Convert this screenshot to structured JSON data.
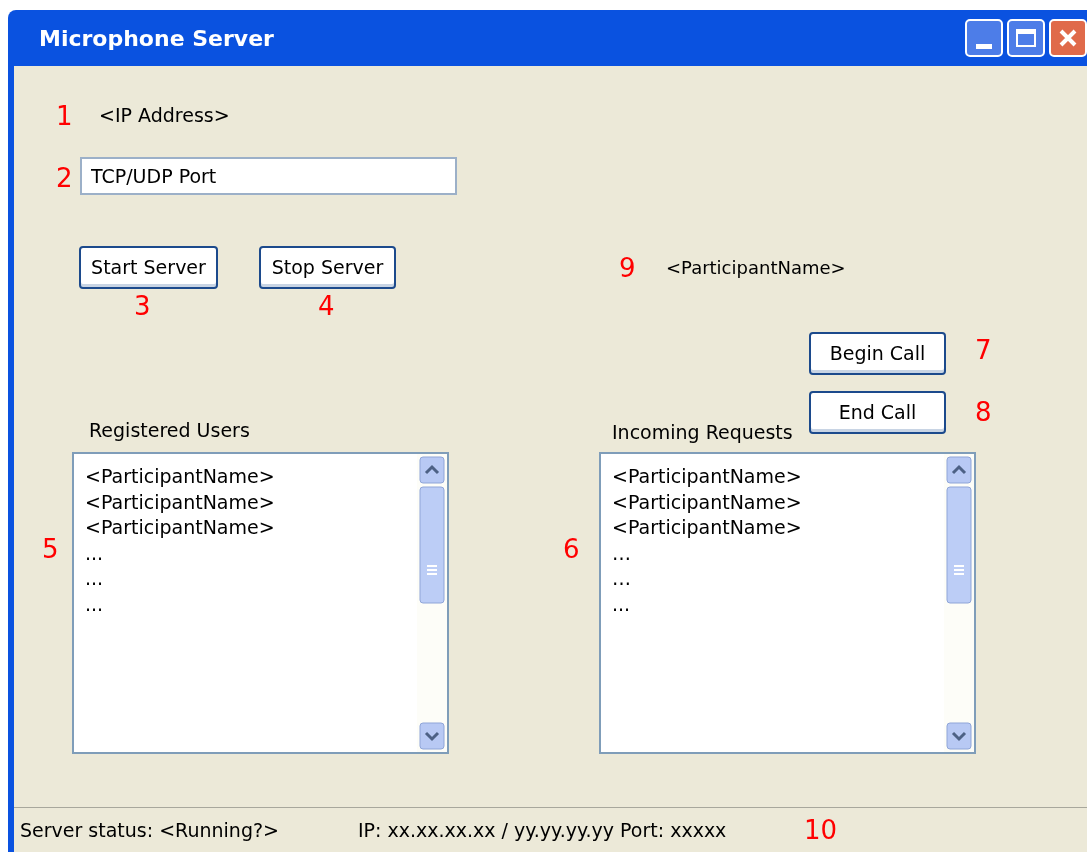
{
  "window": {
    "title": "Microphone Server"
  },
  "ip_address": "<IP Address>",
  "port_field": {
    "value": "TCP/UDP Port"
  },
  "buttons": [
    {
      "label": "Start Server"
    },
    {
      "label": "Stop Server"
    },
    {
      "label": "Begin Call"
    },
    {
      "label": "End Call"
    }
  ],
  "participant_name": "<ParticipantName>",
  "lists": [
    {
      "title": "Registered Users",
      "items": [
        "<ParticipantName>",
        "<ParticipantName>",
        "<ParticipantName>",
        "...",
        "...",
        "..."
      ]
    },
    {
      "title": "Incoming Requests",
      "items": [
        "<ParticipantName>",
        "<ParticipantName>",
        "<ParticipantName>",
        "…",
        "…",
        "..."
      ]
    }
  ],
  "annotations": [
    "1",
    "2",
    "3",
    "4",
    "5",
    "6",
    "7",
    "8",
    "9",
    "10"
  ],
  "status_bar": {
    "status": "Server status: <Running?>",
    "address": "IP: xx.xx.xx.xx / yy.yy.yy.yy Port: xxxxx"
  }
}
